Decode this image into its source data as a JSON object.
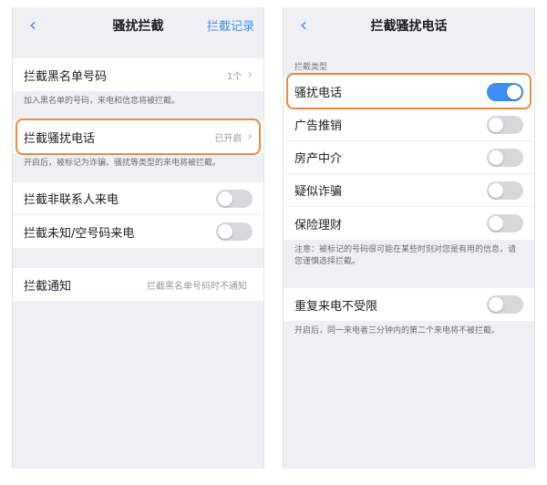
{
  "left": {
    "nav": {
      "back_icon": "chevron-left-icon",
      "title": "骚扰拦截",
      "action": "拦截记录"
    },
    "blacklist": {
      "label": "拦截黑名单号码",
      "value": "1个",
      "note": "加入黑名单的号码，来电和信息将被拦截。"
    },
    "harassment": {
      "label": "拦截骚扰电话",
      "value": "已开启",
      "note": "开启后，被标记为诈骗、骚扰等类型的来电将被拦截。"
    },
    "non_contacts": {
      "label": "拦截非联系人来电",
      "toggle": false
    },
    "unknown": {
      "label": "拦截未知/空号码来电",
      "toggle": false
    },
    "notify": {
      "label": "拦截通知",
      "value": "拦截黑名单号码时不通知"
    }
  },
  "right": {
    "nav": {
      "back_icon": "chevron-left-icon",
      "title": "拦截骚扰电话"
    },
    "section_head": "拦截类型",
    "types": [
      {
        "label": "骚扰电话",
        "toggle": true
      },
      {
        "label": "广告推销",
        "toggle": false
      },
      {
        "label": "房产中介",
        "toggle": false
      },
      {
        "label": "疑似诈骗",
        "toggle": false
      },
      {
        "label": "保险理财",
        "toggle": false
      }
    ],
    "types_note": "注意：被标记的号码很可能在某些时刻对您是有用的信息，请您谨慎选择拦截。",
    "repeat": {
      "label": "重复来电不受限",
      "toggle": false,
      "note": "开启后，同一来电者三分钟内的第二个来电将不被拦截。"
    }
  },
  "colors": {
    "accent": "#3d8ff5",
    "highlight": "#f08a3c",
    "background": "#efeff4"
  }
}
